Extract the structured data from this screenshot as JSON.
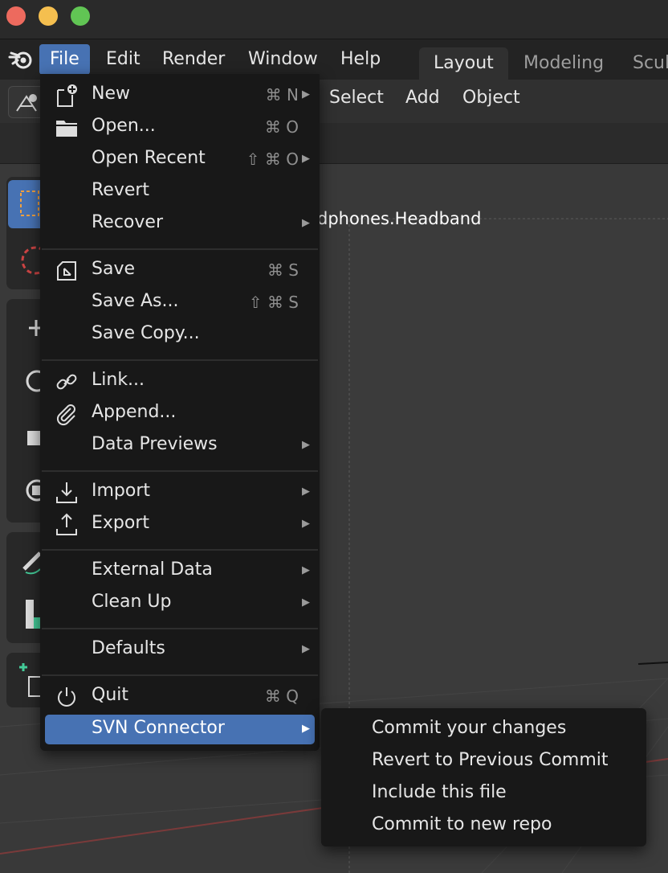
{
  "window": {
    "traffic_lights": {
      "close_color": "#ed6a5e",
      "minimize_color": "#f5bf4f",
      "maximize_color": "#61c554"
    }
  },
  "menubar": {
    "items": [
      {
        "label": "File",
        "active": true
      },
      {
        "label": "Edit"
      },
      {
        "label": "Render"
      },
      {
        "label": "Window"
      },
      {
        "label": "Help"
      }
    ],
    "workspace_tabs": [
      {
        "label": "Layout",
        "active": true
      },
      {
        "label": "Modeling"
      },
      {
        "label": "Scul"
      }
    ]
  },
  "viewport_header": {
    "items": [
      "Select",
      "Add",
      "Object"
    ]
  },
  "viewport": {
    "object_label": "dphones.Headband"
  },
  "file_menu": {
    "items": [
      {
        "label": "New",
        "shortcut": "⌘ N",
        "icon": "new-file-icon",
        "submenu": true
      },
      {
        "label": "Open...",
        "shortcut": "⌘ O",
        "icon": "folder-icon"
      },
      {
        "label": "Open Recent",
        "shortcut": "⇧ ⌘ O",
        "submenu": true
      },
      {
        "label": "Revert"
      },
      {
        "label": "Recover",
        "submenu": true
      },
      {
        "label": "Save",
        "shortcut": "⌘ S",
        "icon": "save-icon"
      },
      {
        "label": "Save As...",
        "shortcut": "⇧ ⌘ S"
      },
      {
        "label": "Save Copy..."
      },
      {
        "label": "Link...",
        "icon": "link-icon"
      },
      {
        "label": "Append...",
        "icon": "paperclip-icon"
      },
      {
        "label": "Data Previews",
        "submenu": true
      },
      {
        "label": "Import",
        "icon": "import-icon",
        "submenu": true
      },
      {
        "label": "Export",
        "icon": "export-icon",
        "submenu": true
      },
      {
        "label": "External Data",
        "submenu": true
      },
      {
        "label": "Clean Up",
        "submenu": true
      },
      {
        "label": "Defaults",
        "submenu": true
      },
      {
        "label": "Quit",
        "shortcut": "⌘ Q",
        "icon": "power-icon"
      },
      {
        "label": "SVN Connector",
        "submenu": true,
        "highlighted": true
      }
    ]
  },
  "svn_submenu": {
    "items": [
      "Commit your changes",
      "Revert to Previous Commit",
      "Include this file",
      "Commit to new repo"
    ]
  },
  "submenu_arrow": "▶",
  "colors": {
    "accent": "#4772b3",
    "menu_bg": "#181818",
    "text": "#e6e6e6",
    "shortcut_text": "#8f8f8f"
  }
}
